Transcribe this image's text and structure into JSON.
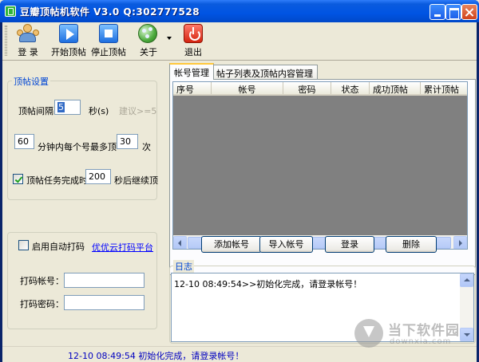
{
  "window": {
    "title": "豆瓣顶帖机软件 V3.0 Q:302777528"
  },
  "toolbar": {
    "login": "登 录",
    "start": "开始顶帖",
    "stop": "停止顶帖",
    "about": "关于",
    "exit": "退出"
  },
  "settings": {
    "group_title": "顶帖设置",
    "interval_label": "顶帖间隔",
    "interval_value": "5",
    "interval_unit": "秒(s)",
    "interval_hint": "建议>=5",
    "minutes_value": "60",
    "per_account_label": "分钟内每个号最多顶",
    "max_times_value": "30",
    "times_unit": "次",
    "continue_checked": true,
    "continue_label": "顶帖任务完成时",
    "continue_value": "200",
    "continue_suffix": "秒后继续顶"
  },
  "captcha": {
    "auto_label": "启用自动打码",
    "auto_checked": false,
    "platform_link": "优优云打码平台",
    "account_label": "打码帐号：",
    "password_label": "打码密码：",
    "account_value": "",
    "password_value": ""
  },
  "tabs": [
    {
      "label": "帐号管理",
      "active": true
    },
    {
      "label": "帖子列表及顶帖内容管理",
      "active": false
    }
  ],
  "accounts": {
    "columns": [
      "序号",
      "帐号",
      "密码",
      "状态",
      "成功顶帖",
      "累计顶帖"
    ],
    "rows": [],
    "buttons": {
      "add": "添加帐号",
      "import": "导入帐号",
      "login": "登录",
      "delete": "删除"
    }
  },
  "log": {
    "title": "日志",
    "lines": [
      "12-10 08:49:54>>初始化完成，请登录帐号！"
    ]
  },
  "status": {
    "text": "12-10 08:49:54 初始化完成，请登录帐号！"
  },
  "watermark": {
    "text": "当下软件园",
    "sub": "downxia.com"
  },
  "colors": {
    "accent": "#0046d5",
    "titlebar": "#0054e3",
    "status_text": "#0000c0",
    "grid_bg": "#808080"
  }
}
